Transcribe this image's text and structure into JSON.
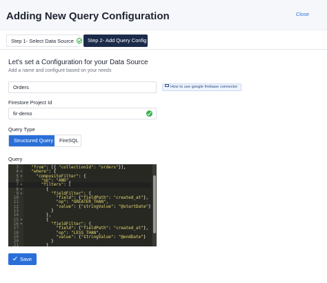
{
  "header": {
    "title": "Adding New Query Configuration",
    "close_label": "Close"
  },
  "steps": [
    {
      "label": "Step 1- Select Data Source",
      "status": "complete"
    },
    {
      "label": "Step 2- Add Query Config",
      "status": "active"
    }
  ],
  "form": {
    "section_title": "Let's set a Configuration for your Data Source",
    "section_subtitle": "Add a name and configure based on your needs",
    "name_value": "Orders",
    "help_link": "How to use google firebase connector",
    "project_label": "Firestore Project Id",
    "project_value": "fir-demo",
    "query_type_label": "Query Type",
    "query_types": [
      "Structured Query",
      "FireSQL"
    ],
    "selected_query_type": "Structured Query",
    "query_label": "Query"
  },
  "editor": {
    "lines": [
      {
        "n": "3",
        "fold": "",
        "text": "  \"from\": [{ \"collectionId\": \"orders\"}],"
      },
      {
        "n": "4",
        "fold": "▾",
        "text": "  \"where\": {"
      },
      {
        "n": "5",
        "fold": "▾",
        "text": "    \"compositeFilter\": {"
      },
      {
        "n": "6",
        "fold": "",
        "text": "      \"op\": \"AND\","
      },
      {
        "n": "7",
        "fold": "▾",
        "text": "      \"filters\": ["
      },
      {
        "n": "8",
        "fold": "▾",
        "text": "        {"
      },
      {
        "n": "9",
        "fold": "▾",
        "text": "          \"fieldFilter\": {"
      },
      {
        "n": "10",
        "fold": "",
        "text": "            \"field\": {\"fieldPath\": \"created_at\"},"
      },
      {
        "n": "11",
        "fold": "",
        "text": "            \"op\": \"GREATER_THAN\","
      },
      {
        "n": "12",
        "fold": "",
        "text": "            \"value\": {\"stringValue\": \"@startDate\"}"
      },
      {
        "n": "13",
        "fold": "",
        "text": "          }"
      },
      {
        "n": "14",
        "fold": "",
        "text": "        },"
      },
      {
        "n": "15",
        "fold": "▾",
        "text": "        {"
      },
      {
        "n": "16",
        "fold": "▾",
        "text": "          \"fieldFilter\": {"
      },
      {
        "n": "17",
        "fold": "",
        "text": "            \"field\": {\"fieldPath\": \"created_at\"},"
      },
      {
        "n": "18",
        "fold": "",
        "text": "            \"op\": \"LESS_THAN\","
      },
      {
        "n": "19",
        "fold": "",
        "text": "            \"value\": {\"stringValue\": \"@endDate\"}"
      },
      {
        "n": "20",
        "fold": "",
        "text": "          }"
      },
      {
        "n": "21",
        "fold": "",
        "text": "        }"
      }
    ],
    "active_line": "7"
  },
  "actions": {
    "save_label": "Save"
  },
  "colors": {
    "primary": "#2a6fd8",
    "dark_step": "#1b2b4a",
    "success": "#34b34a",
    "editor_bg": "#272822",
    "string": "#e6db74"
  }
}
